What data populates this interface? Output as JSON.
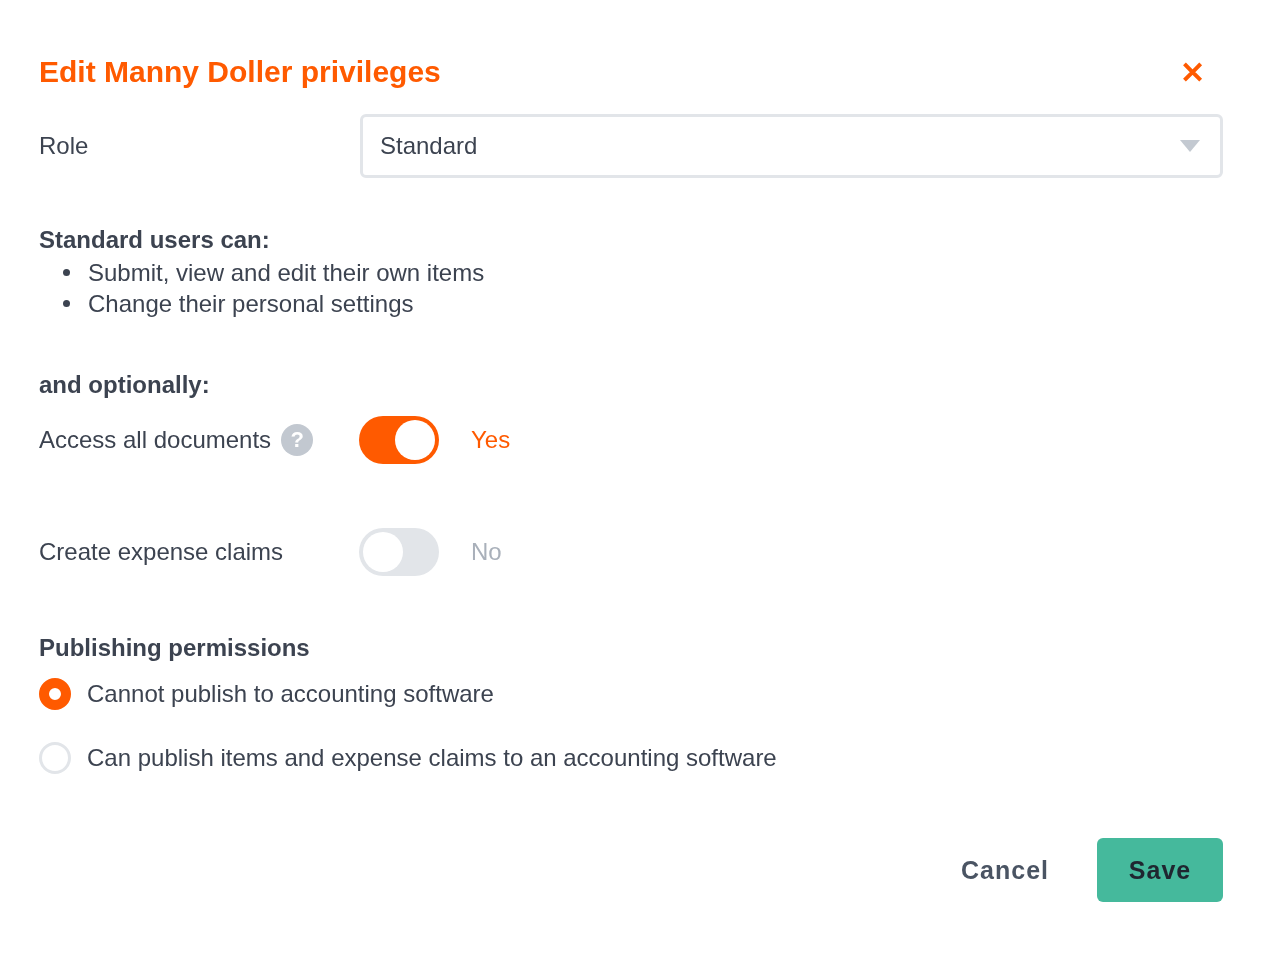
{
  "dialog": {
    "title": "Edit Manny Doller privileges",
    "close": "✕"
  },
  "role": {
    "label": "Role",
    "value": "Standard"
  },
  "description": {
    "heading": "Standard users can:",
    "items": [
      "Submit, view and edit their own items",
      "Change their personal settings"
    ]
  },
  "options": {
    "heading": "and optionally:",
    "toggles": [
      {
        "label": "Access all documents",
        "help": "?",
        "on": true,
        "state_text": "Yes"
      },
      {
        "label": "Create expense claims",
        "on": false,
        "state_text": "No"
      }
    ]
  },
  "publishing": {
    "heading": "Publishing permissions",
    "choices": [
      {
        "label": "Cannot publish to accounting software",
        "selected": true
      },
      {
        "label": "Can publish items and expense claims to an accounting software",
        "selected": false
      }
    ]
  },
  "buttons": [
    {
      "label": "Cancel",
      "kind": "secondary"
    },
    {
      "label": "Save",
      "kind": "primary"
    }
  ]
}
